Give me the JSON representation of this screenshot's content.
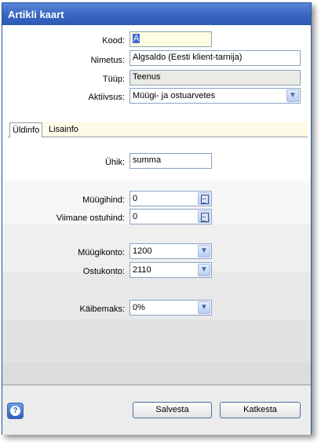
{
  "window": {
    "title": "Artikli kaart"
  },
  "form": {
    "kood": {
      "label": "Kood:",
      "value": "A"
    },
    "nimetus": {
      "label": "Nimetus:",
      "value": "Algsaldo (Eesti klient-tarnija)"
    },
    "tyyp": {
      "label": "Tüüp:",
      "value": "Teenus"
    },
    "aktiivsus": {
      "label": "Aktiivsus:",
      "value": "Müügi- ja ostuarvetes"
    }
  },
  "tabs": [
    {
      "label": "Üldinfo",
      "active": true
    },
    {
      "label": "Lisainfo",
      "active": false
    }
  ],
  "general": {
    "yhik": {
      "label": "Ühik:",
      "value": "summa"
    },
    "myygihind": {
      "label": "Müügihind:",
      "value": "0"
    },
    "viimane_ostuhind": {
      "label": "Viimane ostuhind:",
      "value": "0"
    },
    "myygikonto": {
      "label": "Müügikonto:",
      "value": "1200"
    },
    "ostukonto": {
      "label": "Ostukonto:",
      "value": "2110"
    },
    "kaibemaks": {
      "label": "Käibemaks:",
      "value": "0%"
    }
  },
  "buttons": {
    "save": "Salvesta",
    "cancel": "Katkesta"
  },
  "icons": {
    "dropdown": "chevron-down-icon",
    "calculator": "calculator-icon",
    "help": "help-icon"
  },
  "colors": {
    "titlebar": "#3766c0",
    "required_field": "#fffde0",
    "readonly_field": "#eceae5"
  }
}
